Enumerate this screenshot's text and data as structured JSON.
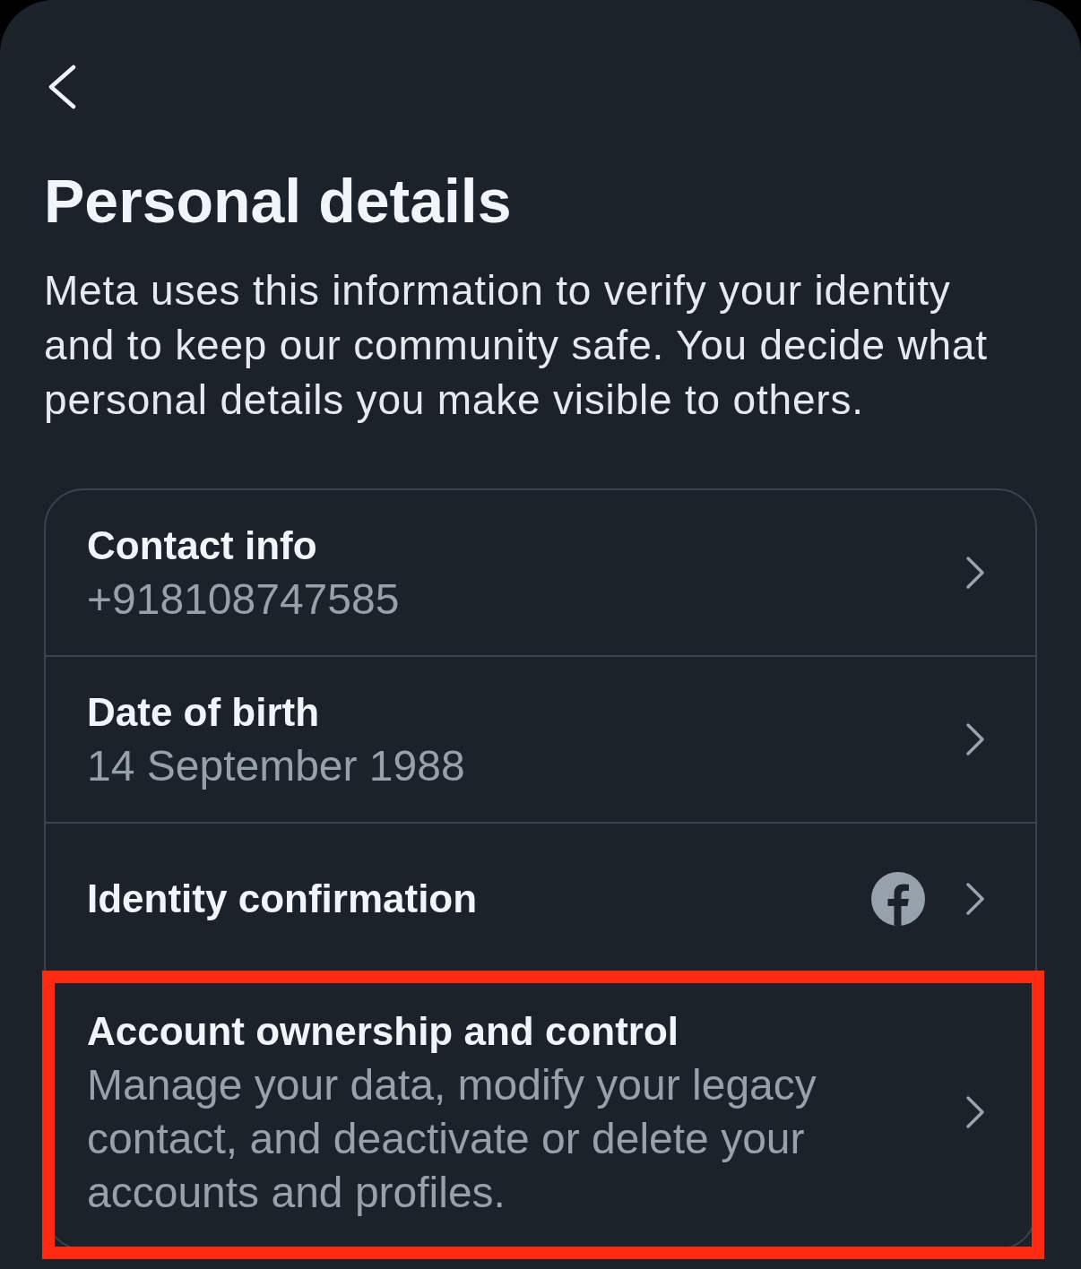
{
  "title": "Personal details",
  "description": "Meta uses this information to verify your identity and to keep our community safe. You decide what personal details you make visible to others.",
  "items": [
    {
      "kind": "detail",
      "label": "Contact info",
      "value": "+918108747585",
      "highlighted": false
    },
    {
      "kind": "detail",
      "label": "Date of birth",
      "value": "14 September 1988",
      "highlighted": false
    },
    {
      "kind": "linked",
      "label": "Identity confirmation",
      "highlighted": false
    },
    {
      "kind": "detail",
      "label": "Account ownership and control",
      "value": "Manage your data, modify your legacy contact, and deactivate or delete your accounts and profiles.",
      "highlighted": true
    }
  ]
}
